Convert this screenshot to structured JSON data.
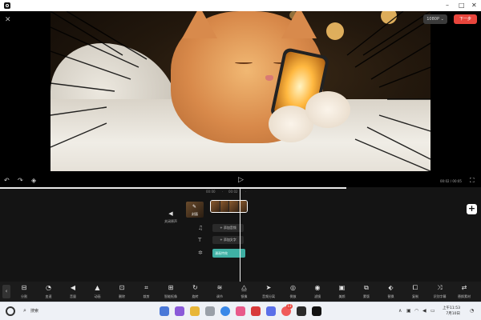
{
  "window": {
    "minimize": "–",
    "maximize": "□",
    "close": "✕"
  },
  "preview": {
    "close_icon": "✕",
    "quality_label": "1080P ⌄",
    "next_label": "下一步"
  },
  "playback": {
    "undo_icon": "↶",
    "redo_icon": "↷",
    "keyframe_icon": "◈",
    "play_icon": "▷",
    "time_display": "00:02 / 00:05",
    "fullscreen_icon": "⛶"
  },
  "timeline": {
    "ruler_marks": [
      "00:00",
      "·",
      "00:02",
      "·"
    ],
    "progress_pct": 72,
    "audio_toggle_label": "关闭原声",
    "cover_label": "封面",
    "add_icon": "+",
    "music_icon": "♫",
    "add_audio_label": "+ 添加音频",
    "text_icon": "T",
    "add_text_label": "+ 添加文字",
    "effect_icon": "✲",
    "effect_tag_label": "漫画特效"
  },
  "toolbar": {
    "collapse_icon": "‹",
    "tools": [
      {
        "icon": "⊟",
        "label": "分割"
      },
      {
        "icon": "◔",
        "label": "变速"
      },
      {
        "icon": "◀",
        "label": "音量"
      },
      {
        "icon": "▲",
        "label": "动画"
      },
      {
        "icon": "⊡",
        "label": "删除"
      },
      {
        "icon": "⌗",
        "label": "裁剪"
      },
      {
        "icon": "⊞",
        "label": "智能抠像"
      },
      {
        "icon": "↻",
        "label": "旋转"
      },
      {
        "icon": "≋",
        "label": "调节"
      },
      {
        "icon": "⧋",
        "label": "镜像"
      },
      {
        "icon": "➤",
        "label": "音频分离"
      },
      {
        "icon": "◎",
        "label": "倒放"
      },
      {
        "icon": "◉",
        "label": "滤镜"
      },
      {
        "icon": "▣",
        "label": "美颜"
      },
      {
        "icon": "⧉",
        "label": "蒙版"
      },
      {
        "icon": "⬖",
        "label": "替换"
      },
      {
        "icon": "⧠",
        "label": "复制"
      },
      {
        "icon": "⤨",
        "label": "识别字幕"
      },
      {
        "icon": "⇄",
        "label": "替换素材"
      }
    ]
  },
  "taskbar": {
    "search_icon": "🔍",
    "search_label": "搜索",
    "badge_count": "13",
    "chevron": "∧",
    "clock_time": "上午11:53",
    "clock_date": "7月10日"
  }
}
